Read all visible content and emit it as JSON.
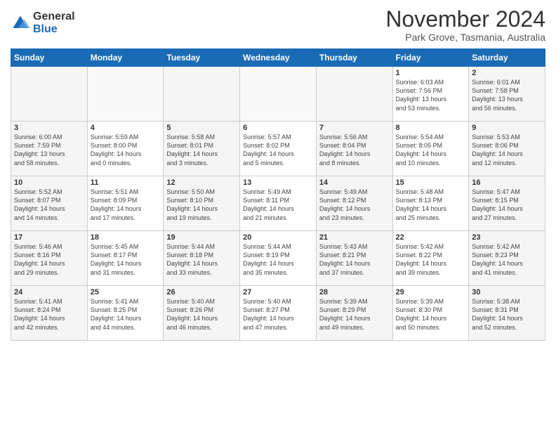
{
  "logo": {
    "general": "General",
    "blue": "Blue"
  },
  "header": {
    "month": "November 2024",
    "location": "Park Grove, Tasmania, Australia"
  },
  "days_of_week": [
    "Sunday",
    "Monday",
    "Tuesday",
    "Wednesday",
    "Thursday",
    "Friday",
    "Saturday"
  ],
  "weeks": [
    [
      {
        "day": "",
        "info": ""
      },
      {
        "day": "",
        "info": ""
      },
      {
        "day": "",
        "info": ""
      },
      {
        "day": "",
        "info": ""
      },
      {
        "day": "",
        "info": ""
      },
      {
        "day": "1",
        "info": "Sunrise: 6:03 AM\nSunset: 7:56 PM\nDaylight: 13 hours\nand 53 minutes."
      },
      {
        "day": "2",
        "info": "Sunrise: 6:01 AM\nSunset: 7:58 PM\nDaylight: 13 hours\nand 56 minutes."
      }
    ],
    [
      {
        "day": "3",
        "info": "Sunrise: 6:00 AM\nSunset: 7:59 PM\nDaylight: 13 hours\nand 58 minutes."
      },
      {
        "day": "4",
        "info": "Sunrise: 5:59 AM\nSunset: 8:00 PM\nDaylight: 14 hours\nand 0 minutes."
      },
      {
        "day": "5",
        "info": "Sunrise: 5:58 AM\nSunset: 8:01 PM\nDaylight: 14 hours\nand 3 minutes."
      },
      {
        "day": "6",
        "info": "Sunrise: 5:57 AM\nSunset: 8:02 PM\nDaylight: 14 hours\nand 5 minutes."
      },
      {
        "day": "7",
        "info": "Sunrise: 5:56 AM\nSunset: 8:04 PM\nDaylight: 14 hours\nand 8 minutes."
      },
      {
        "day": "8",
        "info": "Sunrise: 5:54 AM\nSunset: 8:05 PM\nDaylight: 14 hours\nand 10 minutes."
      },
      {
        "day": "9",
        "info": "Sunrise: 5:53 AM\nSunset: 8:06 PM\nDaylight: 14 hours\nand 12 minutes."
      }
    ],
    [
      {
        "day": "10",
        "info": "Sunrise: 5:52 AM\nSunset: 8:07 PM\nDaylight: 14 hours\nand 14 minutes."
      },
      {
        "day": "11",
        "info": "Sunrise: 5:51 AM\nSunset: 8:09 PM\nDaylight: 14 hours\nand 17 minutes."
      },
      {
        "day": "12",
        "info": "Sunrise: 5:50 AM\nSunset: 8:10 PM\nDaylight: 14 hours\nand 19 minutes."
      },
      {
        "day": "13",
        "info": "Sunrise: 5:49 AM\nSunset: 8:11 PM\nDaylight: 14 hours\nand 21 minutes."
      },
      {
        "day": "14",
        "info": "Sunrise: 5:49 AM\nSunset: 8:12 PM\nDaylight: 14 hours\nand 23 minutes."
      },
      {
        "day": "15",
        "info": "Sunrise: 5:48 AM\nSunset: 8:13 PM\nDaylight: 14 hours\nand 25 minutes."
      },
      {
        "day": "16",
        "info": "Sunrise: 5:47 AM\nSunset: 8:15 PM\nDaylight: 14 hours\nand 27 minutes."
      }
    ],
    [
      {
        "day": "17",
        "info": "Sunrise: 5:46 AM\nSunset: 8:16 PM\nDaylight: 14 hours\nand 29 minutes."
      },
      {
        "day": "18",
        "info": "Sunrise: 5:45 AM\nSunset: 8:17 PM\nDaylight: 14 hours\nand 31 minutes."
      },
      {
        "day": "19",
        "info": "Sunrise: 5:44 AM\nSunset: 8:18 PM\nDaylight: 14 hours\nand 33 minutes."
      },
      {
        "day": "20",
        "info": "Sunrise: 5:44 AM\nSunset: 8:19 PM\nDaylight: 14 hours\nand 35 minutes."
      },
      {
        "day": "21",
        "info": "Sunrise: 5:43 AM\nSunset: 8:21 PM\nDaylight: 14 hours\nand 37 minutes."
      },
      {
        "day": "22",
        "info": "Sunrise: 5:42 AM\nSunset: 8:22 PM\nDaylight: 14 hours\nand 39 minutes."
      },
      {
        "day": "23",
        "info": "Sunrise: 5:42 AM\nSunset: 8:23 PM\nDaylight: 14 hours\nand 41 minutes."
      }
    ],
    [
      {
        "day": "24",
        "info": "Sunrise: 5:41 AM\nSunset: 8:24 PM\nDaylight: 14 hours\nand 42 minutes."
      },
      {
        "day": "25",
        "info": "Sunrise: 5:41 AM\nSunset: 8:25 PM\nDaylight: 14 hours\nand 44 minutes."
      },
      {
        "day": "26",
        "info": "Sunrise: 5:40 AM\nSunset: 8:26 PM\nDaylight: 14 hours\nand 46 minutes."
      },
      {
        "day": "27",
        "info": "Sunrise: 5:40 AM\nSunset: 8:27 PM\nDaylight: 14 hours\nand 47 minutes."
      },
      {
        "day": "28",
        "info": "Sunrise: 5:39 AM\nSunset: 8:29 PM\nDaylight: 14 hours\nand 49 minutes."
      },
      {
        "day": "29",
        "info": "Sunrise: 5:39 AM\nSunset: 8:30 PM\nDaylight: 14 hours\nand 50 minutes."
      },
      {
        "day": "30",
        "info": "Sunrise: 5:38 AM\nSunset: 8:31 PM\nDaylight: 14 hours\nand 52 minutes."
      }
    ]
  ]
}
